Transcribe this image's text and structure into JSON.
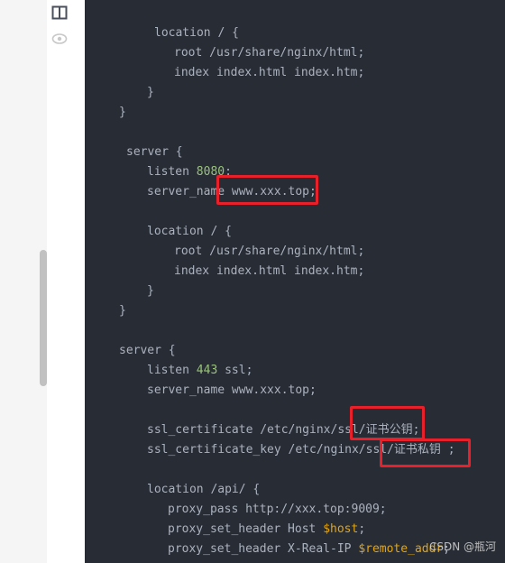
{
  "toolbar": {
    "icons": [
      "split-view-icon",
      "preview-eye-icon"
    ]
  },
  "code_lines": [
    {
      "indent": 171,
      "text": "location / {"
    },
    {
      "indent": 193,
      "text": "root /usr/share/nginx/html;"
    },
    {
      "indent": 193,
      "text": "index index.html index.htm;"
    },
    {
      "indent": 163,
      "text": "}"
    },
    {
      "indent": 132,
      "text": "}"
    },
    {
      "indent": 132,
      "text": ""
    },
    {
      "indent": 140,
      "text": "server {"
    },
    {
      "indent": 163,
      "pre": "listen ",
      "num": "8080",
      "post": ";"
    },
    {
      "indent": 163,
      "text": "server_name www.xxx.top;"
    },
    {
      "indent": 163,
      "text": ""
    },
    {
      "indent": 163,
      "text": "location / {"
    },
    {
      "indent": 193,
      "text": "root /usr/share/nginx/html;"
    },
    {
      "indent": 193,
      "text": "index index.html index.htm;"
    },
    {
      "indent": 163,
      "text": "}"
    },
    {
      "indent": 132,
      "text": "}"
    },
    {
      "indent": 132,
      "text": ""
    },
    {
      "indent": 132,
      "text": "server {"
    },
    {
      "indent": 163,
      "pre": "listen ",
      "num": "443",
      "post": " ssl;"
    },
    {
      "indent": 163,
      "text": "server_name www.xxx.top;"
    },
    {
      "indent": 163,
      "text": ""
    },
    {
      "indent": 163,
      "text": "ssl_certificate /etc/nginx/ssl/证书公钥;"
    },
    {
      "indent": 163,
      "text": "ssl_certificate_key /etc/nginx/ssl/证书私钥 ;"
    },
    {
      "indent": 163,
      "text": ""
    },
    {
      "indent": 163,
      "text": "location /api/ {"
    },
    {
      "indent": 186,
      "text": "proxy_pass http://xxx.top:9009;"
    },
    {
      "indent": 186,
      "pre": "proxy_set_header Host ",
      "var": "$host",
      "post": ";"
    },
    {
      "indent": 186,
      "pre": "proxy_set_header X-Real-IP ",
      "var": "$remote_addr",
      "post": ";"
    }
  ],
  "highlight_color": "#e8202a",
  "watermark": "CSDN @瓶河"
}
